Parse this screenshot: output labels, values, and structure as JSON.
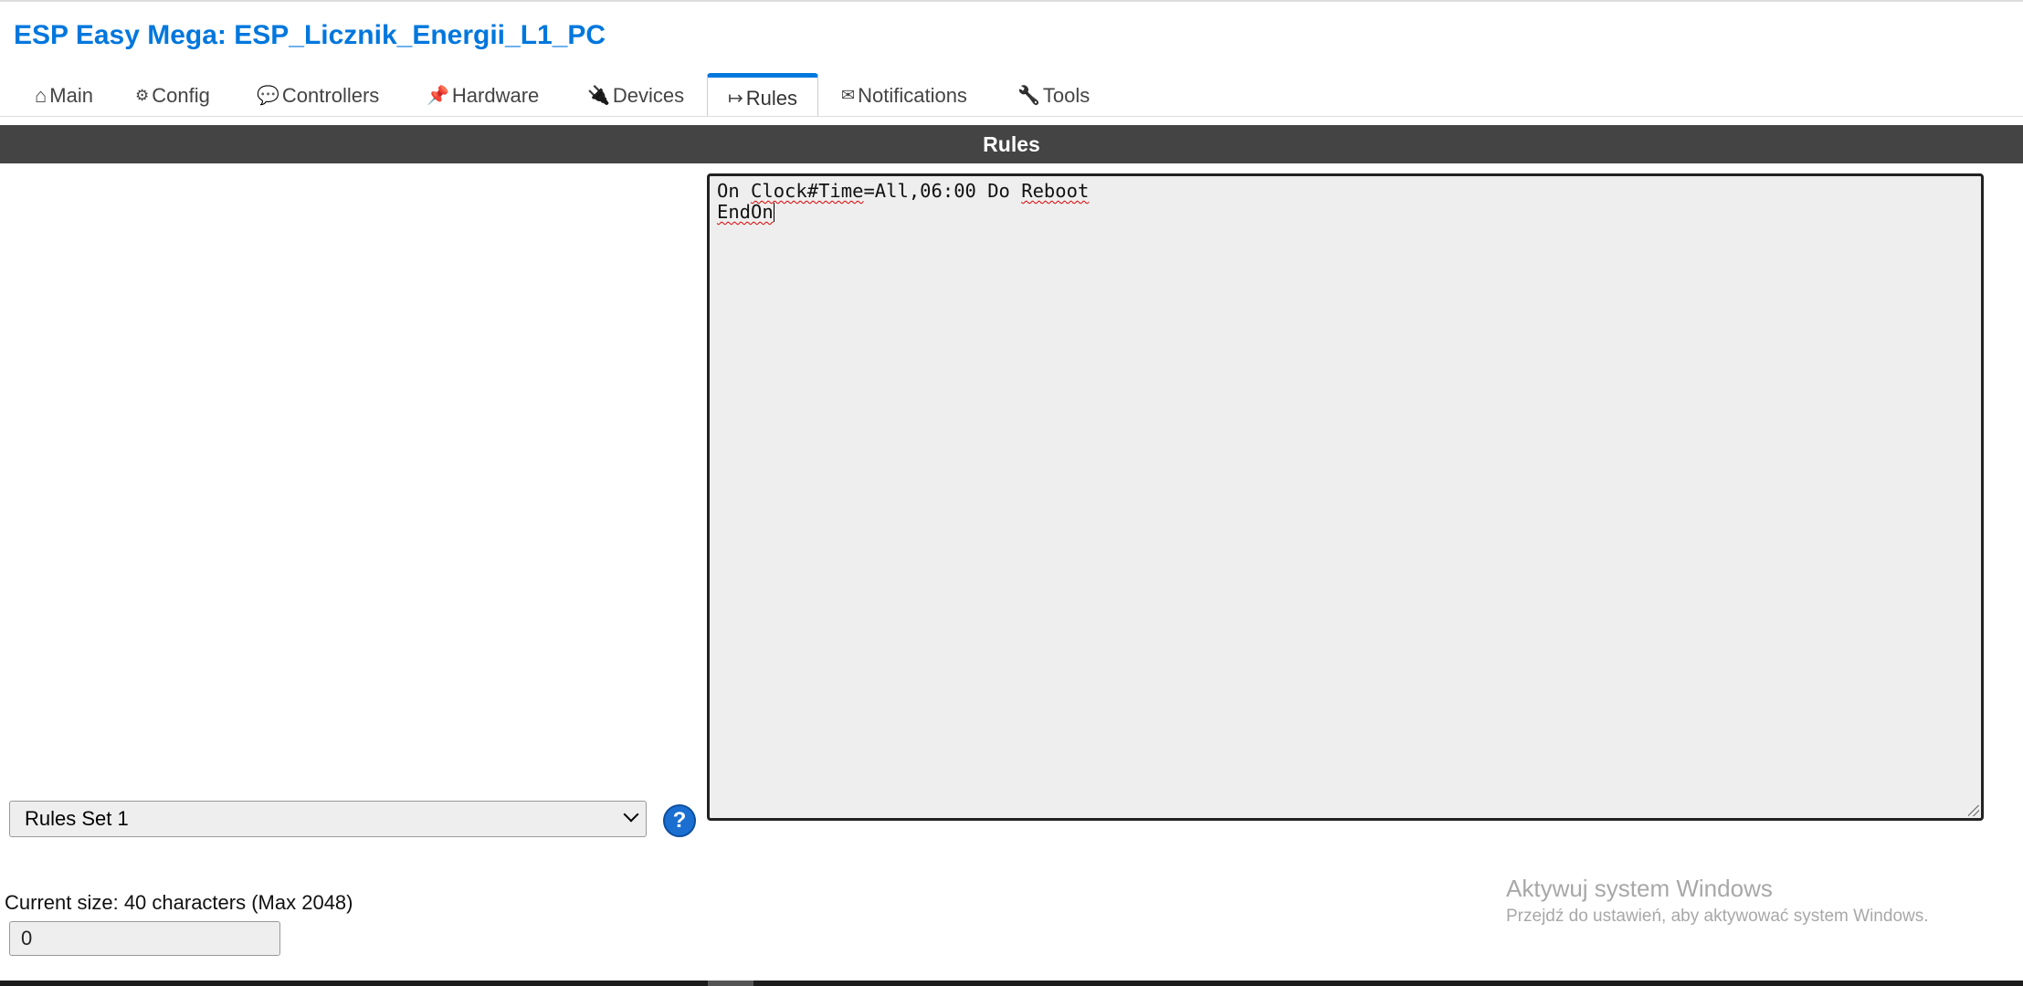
{
  "header": {
    "title": "ESP Easy Mega: ESP_Licznik_Energii_L1_PC"
  },
  "tabs": [
    {
      "icon": "home-icon",
      "glyph": "⌂",
      "label": "Main",
      "active": false
    },
    {
      "icon": "gear-icon",
      "glyph": "⚙",
      "label": "Config",
      "active": false
    },
    {
      "icon": "speech-bubble-icon",
      "glyph": "💬",
      "label": "Controllers",
      "active": false
    },
    {
      "icon": "pushpin-icon",
      "glyph": "📌",
      "label": "Hardware",
      "active": false
    },
    {
      "icon": "plug-icon",
      "glyph": "🔌",
      "label": "Devices",
      "active": false
    },
    {
      "icon": "arrow-right-icon",
      "glyph": "↦",
      "label": "Rules",
      "active": true
    },
    {
      "icon": "envelope-icon",
      "glyph": "✉",
      "label": "Notifications",
      "active": false
    },
    {
      "icon": "wrench-icon",
      "glyph": "🔧",
      "label": "Tools",
      "active": false
    }
  ],
  "section": {
    "title": "Rules"
  },
  "rules_editor": {
    "line1_a": "On ",
    "line1_b": "Clock#Time",
    "line1_c": "=All,06:00 Do ",
    "line1_d": "Reboot",
    "line2": "EndOn"
  },
  "rules_set": {
    "selected": "Rules Set 1"
  },
  "help": {
    "glyph": "?"
  },
  "size_info": {
    "label": "Current size: 40 characters (Max 2048)",
    "value": "0"
  },
  "watermark": {
    "title": "Aktywuj system Windows",
    "subtitle": "Przejdź do ustawień, aby aktywować system Windows."
  },
  "colors": {
    "accent": "#0077dd",
    "section_bar": "#444444",
    "editor_bg": "#eeeeee"
  }
}
